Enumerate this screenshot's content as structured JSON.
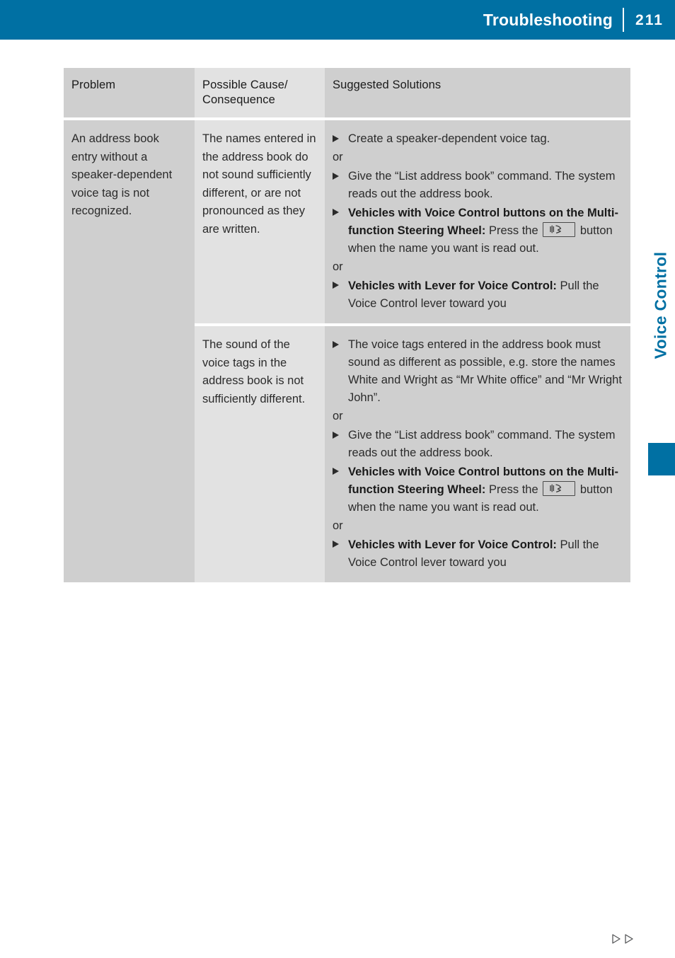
{
  "header": {
    "title": "Troubleshooting",
    "page_number": "211",
    "background_color": "#0070a3",
    "text_color": "#ffffff"
  },
  "side_tab": {
    "label": "Voice Control",
    "color": "#0070a3"
  },
  "table": {
    "columns": [
      {
        "key": "problem",
        "header": "Problem"
      },
      {
        "key": "cause",
        "header": "Possible Cause/\nConsequence"
      },
      {
        "key": "solutions",
        "header": "Suggested Solutions"
      }
    ],
    "header_labels": {
      "problem": "Problem",
      "cause_line1": "Possible Cause/",
      "cause_line2": "Consequence",
      "solutions": "Suggested Solutions"
    },
    "rows": [
      {
        "problem": "An address book entry without a speaker-dependent voice tag is not recognized.",
        "cause": "The names entered in the address book do not sound sufficiently different, or are not pronounced as they are written.",
        "solutions": [
          {
            "type": "bullet",
            "text": "Create a speaker-dependent voice tag."
          },
          {
            "type": "or",
            "text": "or"
          },
          {
            "type": "bullet",
            "text": "Give the “List address book” command. The system reads out the address book."
          },
          {
            "type": "bullet-button",
            "bold": "Vehicles with Voice Control buttons on the Multi-function Steering Wheel:",
            "pre": "Press the",
            "post": "button when the name you want is read out."
          },
          {
            "type": "or",
            "text": "or"
          },
          {
            "type": "bullet-bold",
            "bold": "Vehicles with Lever for Voice Control:",
            "rest": "Pull the Voice Control lever toward you"
          }
        ]
      },
      {
        "problem": "",
        "cause": "The sound of the voice tags in the address book is not sufficiently different.",
        "solutions": [
          {
            "type": "bullet",
            "text": "The voice tags entered in the address book must sound as different as possible, e.g. store the names White and Wright as “Mr White office” and “Mr Wright John”."
          },
          {
            "type": "or",
            "text": "or"
          },
          {
            "type": "bullet",
            "text": "Give the “List address book” command. The system reads out the address book."
          },
          {
            "type": "bullet-button",
            "bold": "Vehicles with Voice Control buttons on the Multi-function Steering Wheel:",
            "pre": "Press the",
            "post": "button when the name you want is read out."
          },
          {
            "type": "or",
            "text": "or"
          },
          {
            "type": "bullet-bold",
            "bold": "Vehicles with Lever for Voice Control:",
            "rest": "Pull the Voice Control lever toward you"
          }
        ]
      }
    ],
    "colors": {
      "column_dark": "#cfcfcf",
      "column_light": "#e2e2e2",
      "separator": "#ffffff"
    }
  },
  "icons": {
    "voice_control_button": "voice-control-button-icon",
    "continuation": "continuation-arrows-icon"
  }
}
